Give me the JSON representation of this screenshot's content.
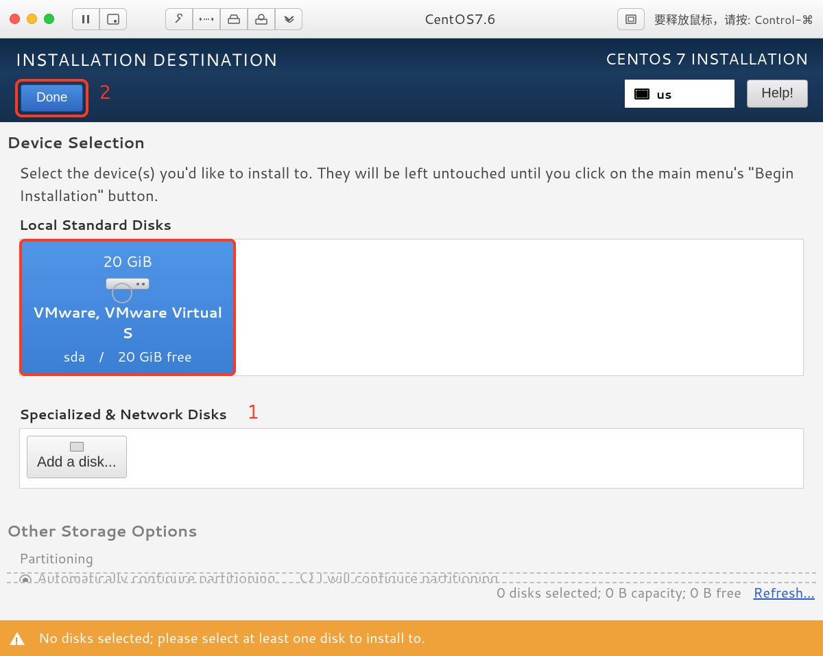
{
  "macbar": {
    "title": "CentOS7.6",
    "mouse_hint": "要释放鼠标，请按: Control-⌘"
  },
  "header": {
    "title": "INSTALLATION DESTINATION",
    "done_label": "Done",
    "right_title": "CENTOS 7 INSTALLATION",
    "keyboard_layout": "us",
    "help_label": "Help!"
  },
  "annotations": {
    "step1": "1",
    "step2": "2"
  },
  "main": {
    "device_selection_heading": "Device Selection",
    "device_selection_desc": "Select the device(s) you'd like to install to.  They will be left untouched until you click on the main menu's \"Begin Installation\" button.",
    "local_disks_label": "Local Standard Disks",
    "disk": {
      "size": "20 GiB",
      "name": "VMware, VMware Virtual S",
      "dev": "sda",
      "sep": "/",
      "free": "20 GiB free"
    },
    "network_disks_label": "Specialized & Network Disks",
    "add_disk_label": "Add a disk...",
    "other_storage_heading": "Other Storage Options",
    "partitioning_label": "Partitioning",
    "radio_auto": "Automatically configure partitioning.",
    "radio_manual": "I will configure partitioning.",
    "status_summary": "0 disks selected; 0 B capacity; 0 B free",
    "refresh_label": "Refresh...",
    "warn_message": "No disks selected; please select at least one disk to install to."
  }
}
